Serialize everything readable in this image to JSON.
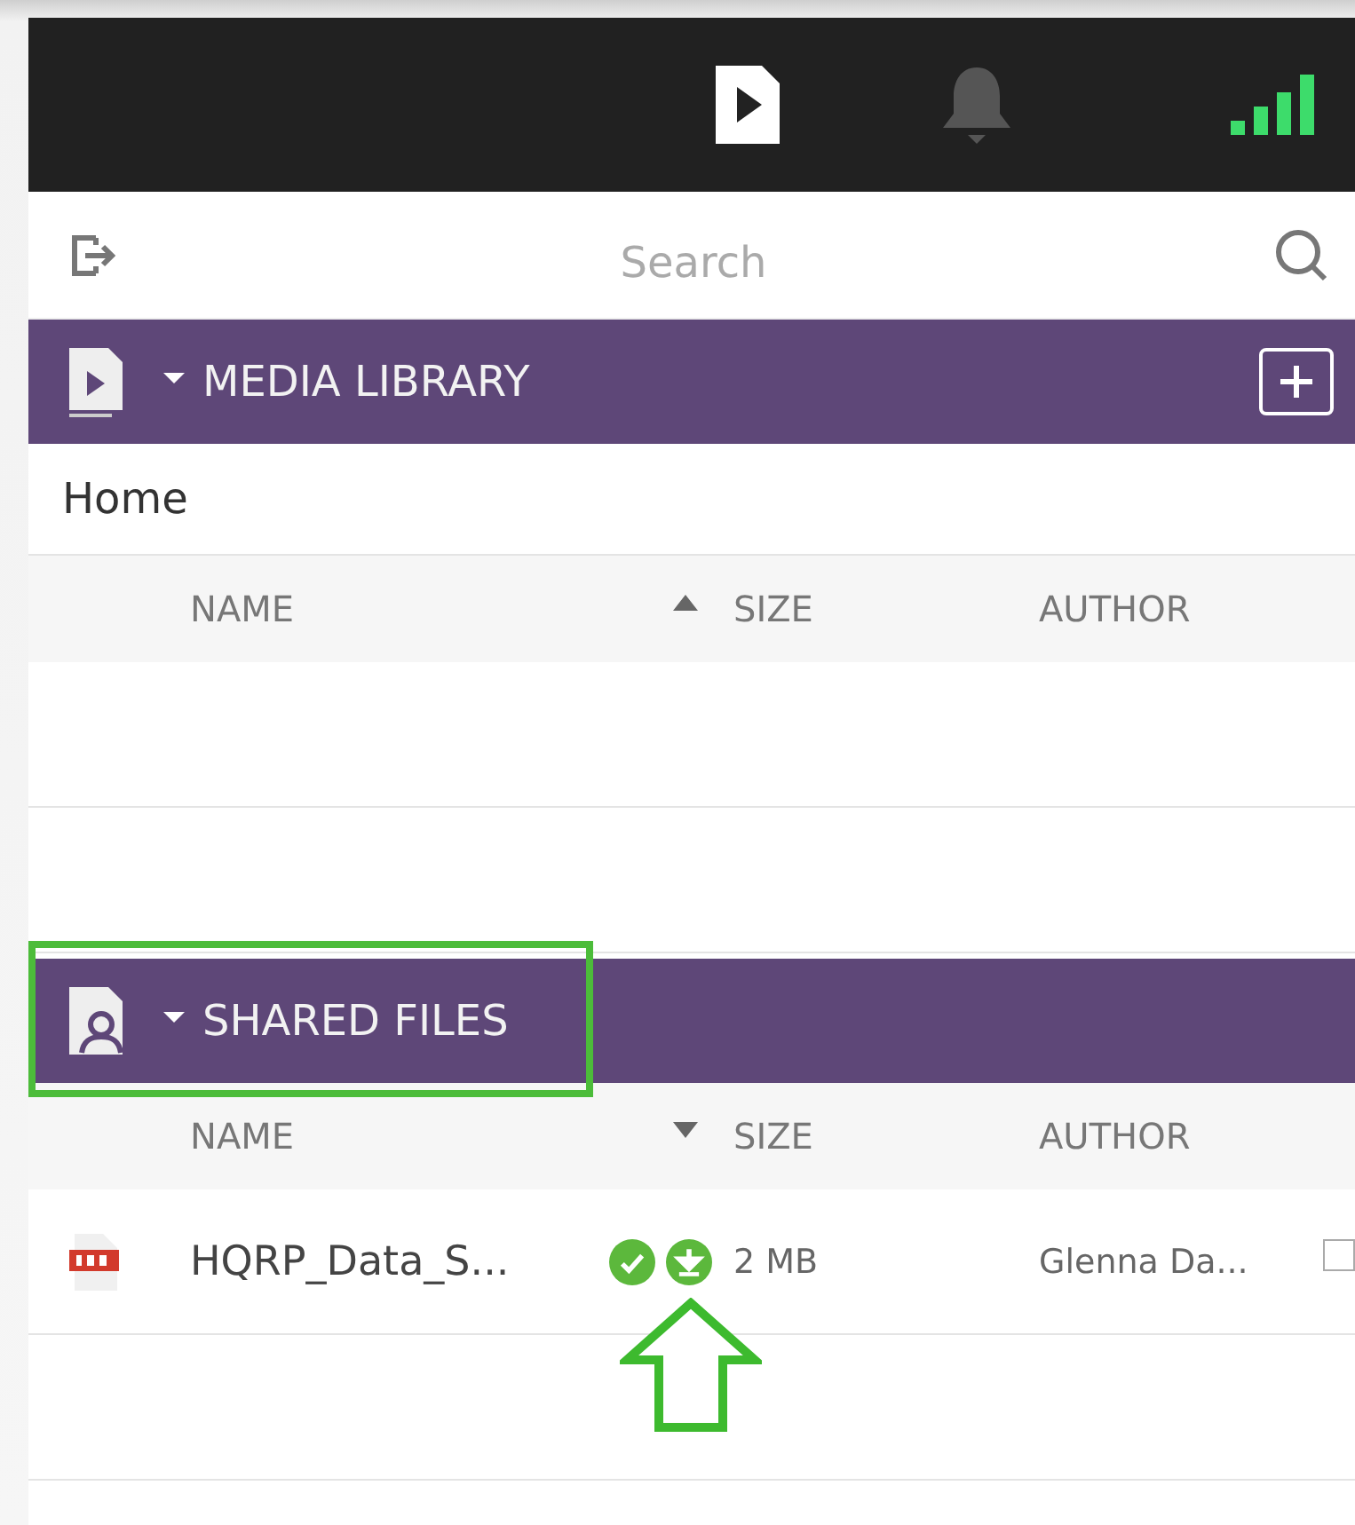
{
  "search": {
    "placeholder": "Search"
  },
  "sections": [
    {
      "kind": "media",
      "title": "MEDIA LIBRARY",
      "expanded": true,
      "add_button": true,
      "breadcrumb": "Home",
      "columns": [
        "NAME",
        "SIZE",
        "AUTHOR"
      ],
      "sort_descending": false
    },
    {
      "kind": "shared",
      "title": "SHARED FILES",
      "expanded": true,
      "add_button": false,
      "columns": [
        "NAME",
        "SIZE",
        "AUTHOR"
      ],
      "sort_descending": true,
      "highlighted": true,
      "rows": [
        {
          "kind": "pdf",
          "name": "HQRP_Data_S...",
          "synced": true,
          "downloadable": true,
          "size": "2 MB",
          "author": "Glenna Da...",
          "selected": false,
          "pointed": true
        }
      ]
    }
  ]
}
